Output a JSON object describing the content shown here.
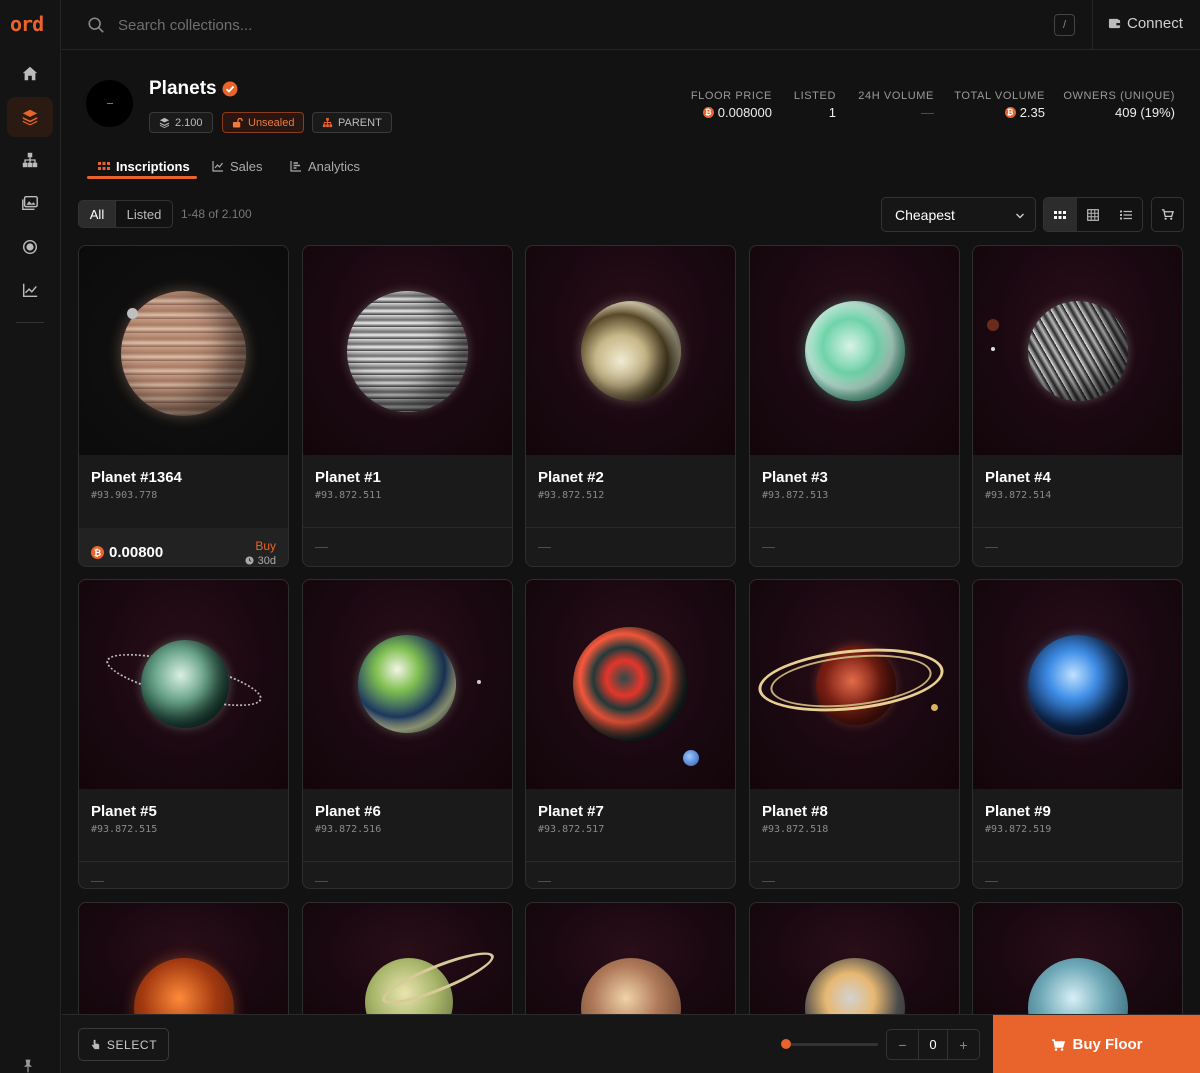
{
  "brand": {
    "logo_text": "ord",
    "accent": "#e8642c"
  },
  "sidebar": {
    "items": [
      {
        "icon": "home-icon"
      },
      {
        "icon": "layers-icon",
        "active": true
      },
      {
        "icon": "sitemap-icon"
      },
      {
        "icon": "gallery-icon"
      },
      {
        "icon": "circle-dot-icon"
      },
      {
        "icon": "chart-line-icon"
      }
    ]
  },
  "topbar": {
    "search_placeholder": "Search collections...",
    "shortcut": "/",
    "connect_label": "Connect"
  },
  "collection": {
    "title": "Planets",
    "supply": "2.100",
    "unsealed_label": "Unsealed",
    "parent_label": "PARENT",
    "stats": [
      {
        "label": "FLOOR PRICE",
        "value": "0.008000",
        "btc": true
      },
      {
        "label": "LISTED",
        "value": "1",
        "btc": false
      },
      {
        "label": "24H VOLUME",
        "value": "—",
        "btc": false
      },
      {
        "label": "TOTAL VOLUME",
        "value": "2.35",
        "btc": true
      },
      {
        "label": "OWNERS (UNIQUE)",
        "value": "409 (19%)",
        "btc": false
      }
    ]
  },
  "tabs": [
    {
      "label": "Inscriptions",
      "active": true
    },
    {
      "label": "Sales",
      "active": false
    },
    {
      "label": "Analytics",
      "active": false
    }
  ],
  "filters": {
    "all_label": "All",
    "listed_label": "Listed",
    "range_text": "1-48 of 2.100",
    "sort_value": "Cheapest"
  },
  "cards": [
    {
      "name": "Planet #1364",
      "id": "#93.903.778",
      "price": "0.00800",
      "buy_label": "Buy",
      "time": "30d",
      "listed": true
    },
    {
      "name": "Planet #1",
      "id": "#93.872.511",
      "placeholder": "—"
    },
    {
      "name": "Planet #2",
      "id": "#93.872.512",
      "placeholder": "—"
    },
    {
      "name": "Planet #3",
      "id": "#93.872.513",
      "placeholder": "—"
    },
    {
      "name": "Planet #4",
      "id": "#93.872.514",
      "placeholder": "—"
    },
    {
      "name": "Planet #5",
      "id": "#93.872.515",
      "placeholder": "—"
    },
    {
      "name": "Planet #6",
      "id": "#93.872.516",
      "placeholder": "—"
    },
    {
      "name": "Planet #7",
      "id": "#93.872.517",
      "placeholder": "—"
    },
    {
      "name": "Planet #8",
      "id": "#93.872.518",
      "placeholder": "—"
    },
    {
      "name": "Planet #9",
      "id": "#93.872.519",
      "placeholder": "—"
    }
  ],
  "bottombar": {
    "select_label": "SELECT",
    "quantity": "0",
    "minus": "−",
    "plus": "+",
    "buy_floor_label": "Buy Floor"
  }
}
